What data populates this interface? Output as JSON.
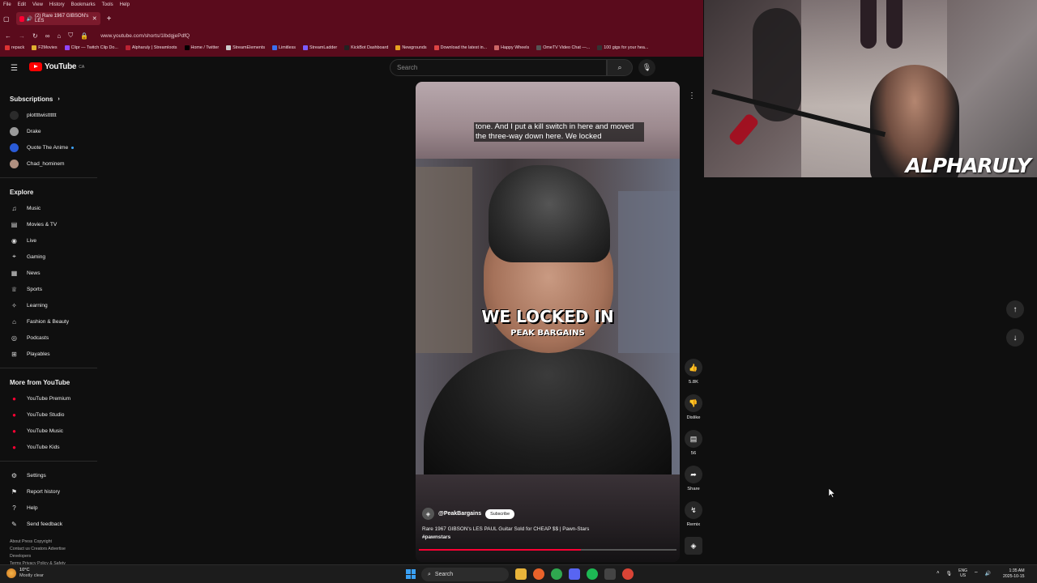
{
  "browser": {
    "menu": [
      "File",
      "Edit",
      "View",
      "History",
      "Bookmarks",
      "Tools",
      "Help"
    ],
    "tab_title": "(2) Rare 1967 GIBSON's LES",
    "url": "www.youtube.com/shorts/1lbdgjePdfQ",
    "bookmarks": [
      "repack",
      "F2Movies",
      "Clipr — Twitch Clip Do...",
      "Alpharuly | Streamloots",
      "Home / Twitter",
      "StreamElements",
      "Limitless",
      "StreamLadder",
      "KickBot Dashboard",
      "Newgrounds",
      "Download the latest in...",
      "Happy Wheels",
      "OmeTV Video Chat —...",
      "100 gigs for your hea..."
    ]
  },
  "youtube": {
    "logo_text": "YouTube",
    "logo_country": "CA",
    "search_placeholder": "Search",
    "sidebar": {
      "subscriptions_title": "Subscriptions",
      "subscriptions": [
        "plottttwistttttt",
        "Drake",
        "Quote The Anime",
        "Chad_hominem"
      ],
      "explore_title": "Explore",
      "explore": [
        "Music",
        "Movies & TV",
        "Live",
        "Gaming",
        "News",
        "Sports",
        "Learning",
        "Fashion & Beauty",
        "Podcasts",
        "Playables"
      ],
      "more_title": "More from YouTube",
      "more": [
        "YouTube Premium",
        "YouTube Studio",
        "YouTube Music",
        "YouTube Kids"
      ],
      "settings": [
        "Settings",
        "Report history",
        "Help",
        "Send feedback"
      ],
      "footer_line1": "About  Press  Copyright",
      "footer_line2": "Contact us  Creators  Advertise",
      "footer_line3": "Developers",
      "footer_line4": "Terms  Privacy  Policy & Safety"
    },
    "short": {
      "caption_top": "tone. And I put a kill switch in here and moved the three-way down here. We locked",
      "caption_big": "WE LOCKED IN",
      "caption_sub": "PEAK BARGAINS",
      "channel": "@PeakBargains",
      "subscribe_label": "Subscribe",
      "title": "Rare 1967 GIBSON's LES PAUL Guitar Sold for CHEAP $$ | Pawn-Stars",
      "hashtag": "#pawnstars",
      "progress": 0.63
    },
    "actions": {
      "like_count": "5.8K",
      "dislike_label": "Dislike",
      "comments_count": "56",
      "share_label": "Share",
      "remix_label": "Remix"
    }
  },
  "overlay": {
    "streamer_name": "ALPHARULY"
  },
  "taskbar": {
    "temp": "10°C",
    "weather": "Mostly clear",
    "search_label": "Search",
    "lang_top": "ENG",
    "lang_bottom": "US",
    "time": "1:35 AM",
    "date": "2025-10-15"
  }
}
